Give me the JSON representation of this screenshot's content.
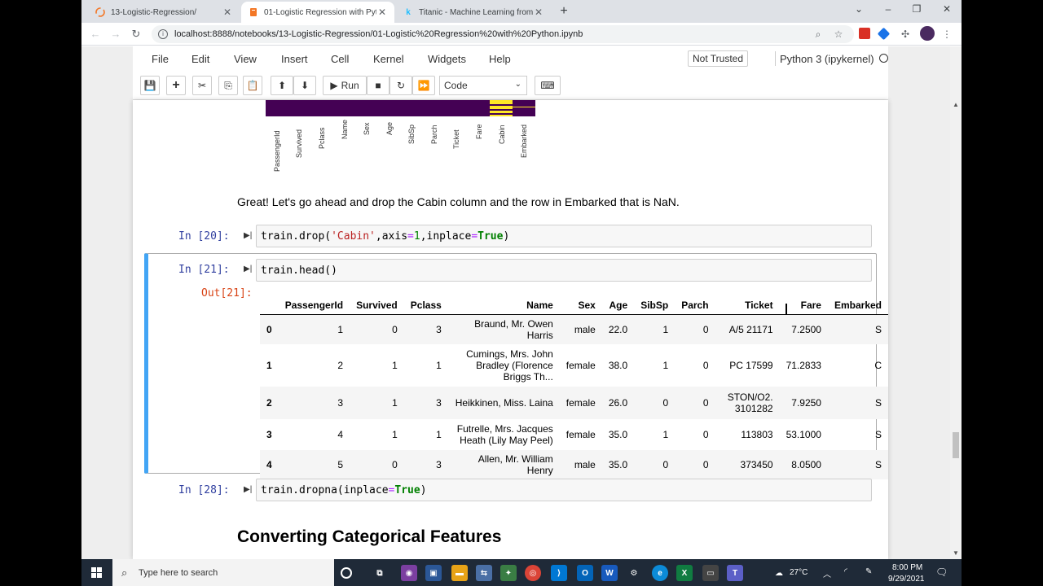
{
  "browser": {
    "tabs": [
      {
        "title": "13-Logistic-Regression/",
        "icon": "jupyter-icon",
        "active": false
      },
      {
        "title": "01-Logistic Regression with Pyth...",
        "icon": "notebook-icon",
        "active": true
      },
      {
        "title": "Titanic - Machine Learning from ...",
        "icon": "kaggle-icon",
        "active": false
      }
    ],
    "url": "localhost:8888/notebooks/13-Logistic-Regression/01-Logistic%20Regression%20with%20Python.ipynb"
  },
  "jupyter": {
    "menu": [
      "File",
      "Edit",
      "View",
      "Insert",
      "Cell",
      "Kernel",
      "Widgets",
      "Help"
    ],
    "trust_status": "Not Trusted",
    "kernel": "Python 3 (ipykernel)",
    "toolbar": {
      "run_label": "Run",
      "cell_type": "Code"
    }
  },
  "heatmap": {
    "columns": [
      "PassengerId",
      "Survived",
      "Pclass",
      "Name",
      "Sex",
      "Age",
      "SibSp",
      "Parch",
      "Ticket",
      "Fare",
      "Cabin",
      "Embarked"
    ],
    "colors": {
      "background": "#440154",
      "missing": "#fde725"
    }
  },
  "markdown_text": "Great! Let's go ahead and drop the Cabin column and the row in Embarked that is NaN.",
  "cells": {
    "c20": {
      "prompt": "In [20]:"
    },
    "c21": {
      "prompt": "In [21]:",
      "code": "train.head()",
      "out_prompt": "Out[21]:"
    },
    "c28": {
      "prompt": "In [28]:"
    }
  },
  "dataframe": {
    "columns": [
      "",
      "PassengerId",
      "Survived",
      "Pclass",
      "Name",
      "Sex",
      "Age",
      "SibSp",
      "Parch",
      "Ticket",
      "Fare",
      "Embarked"
    ],
    "rows": [
      [
        "0",
        "1",
        "0",
        "3",
        "Braund, Mr. Owen Harris",
        "male",
        "22.0",
        "1",
        "0",
        "A/5 21171",
        "7.2500",
        "S"
      ],
      [
        "1",
        "2",
        "1",
        "1",
        "Cumings, Mrs. John Bradley (Florence Briggs Th...",
        "female",
        "38.0",
        "1",
        "0",
        "PC 17599",
        "71.2833",
        "C"
      ],
      [
        "2",
        "3",
        "1",
        "3",
        "Heikkinen, Miss. Laina",
        "female",
        "26.0",
        "0",
        "0",
        "STON/O2. 3101282",
        "7.9250",
        "S"
      ],
      [
        "3",
        "4",
        "1",
        "1",
        "Futrelle, Mrs. Jacques Heath (Lily May Peel)",
        "female",
        "35.0",
        "1",
        "0",
        "113803",
        "53.1000",
        "S"
      ],
      [
        "4",
        "5",
        "0",
        "3",
        "Allen, Mr. William Henry",
        "male",
        "35.0",
        "0",
        "0",
        "373450",
        "8.0500",
        "S"
      ]
    ]
  },
  "heading": "Converting Categorical Features",
  "taskbar": {
    "search_placeholder": "Type here to search",
    "weather": "27°C",
    "time": "8:00 PM",
    "date": "9/29/2021"
  }
}
